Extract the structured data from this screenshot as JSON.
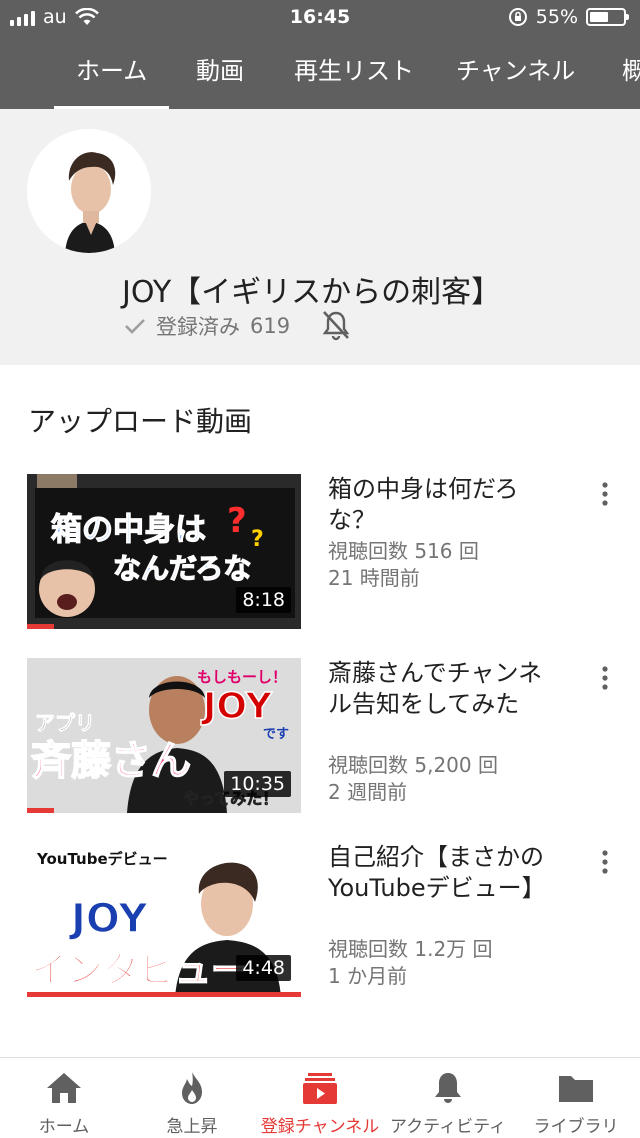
{
  "status_bar": {
    "carrier": "au",
    "time": "16:45",
    "battery_percent": "55%",
    "battery_level": 0.55
  },
  "tabs": [
    {
      "label": "ホーム",
      "active": true
    },
    {
      "label": "動画",
      "active": false
    },
    {
      "label": "再生リスト",
      "active": false
    },
    {
      "label": "チャンネル",
      "active": false
    },
    {
      "label": "概",
      "active": false
    }
  ],
  "channel": {
    "name": "JOY【イギリスからの刺客】",
    "subscribed_label": "登録済み",
    "subscriber_count": "619"
  },
  "uploads": {
    "title": "アップロード動画",
    "videos": [
      {
        "title": "箱の中身は何だろな？",
        "views": "視聴回数 516 回",
        "age": "21 時間前",
        "duration": "8:18",
        "watched_fraction": 0.1,
        "thumb_text": [
          "箱の中身は",
          "なんだろな"
        ]
      },
      {
        "title": "斎藤さんでチャンネル告知をしてみた",
        "views": "視聴回数 5,200 回",
        "age": "2 週間前",
        "duration": "10:35",
        "watched_fraction": 0.1,
        "thumb_text": [
          "もしもーし！",
          "JOY",
          "です",
          "アプリ",
          "斉藤さん",
          "やってみた！"
        ]
      },
      {
        "title": "自己紹介【まさかのYouTubeデビュー】",
        "views": "視聴回数 1.2万 回",
        "age": "1 か月前",
        "duration": "4:48",
        "watched_fraction": 1.0,
        "thumb_text": [
          "YouTubeデビュー",
          "JOY",
          "インタビュー"
        ]
      }
    ]
  },
  "bottom_nav": [
    {
      "label": "ホーム",
      "icon": "home-icon",
      "active": false
    },
    {
      "label": "急上昇",
      "icon": "flame-icon",
      "active": false
    },
    {
      "label": "登録チャンネル",
      "icon": "subscriptions-icon",
      "active": true
    },
    {
      "label": "アクティビティ",
      "icon": "bell-icon",
      "active": false
    },
    {
      "label": "ライブラリ",
      "icon": "folder-icon",
      "active": false
    }
  ],
  "colors": {
    "header_bg": "#5f5f5f",
    "channel_bg": "#f1f1f1",
    "accent_red": "#e53935"
  }
}
